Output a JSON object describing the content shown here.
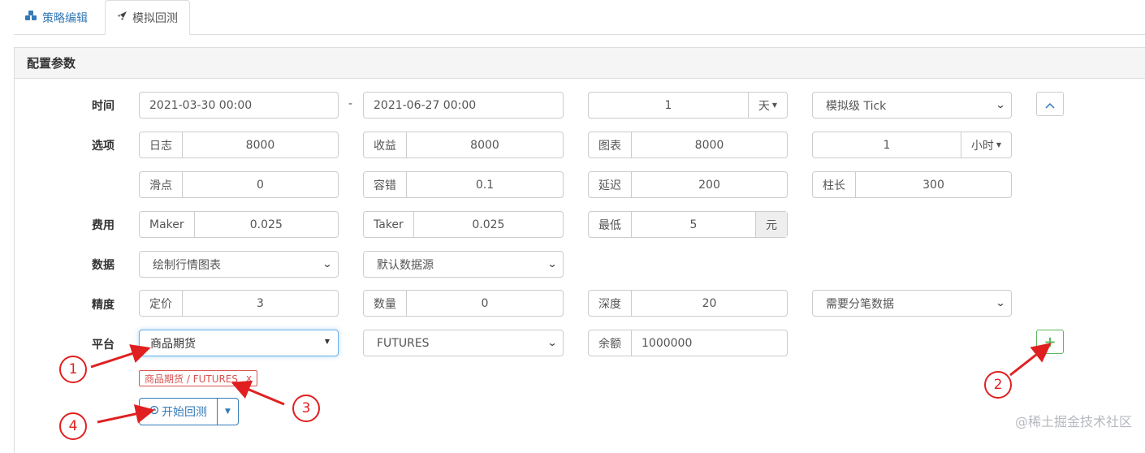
{
  "tabs": {
    "editor": "策略编辑",
    "backtest": "模拟回测"
  },
  "panel": {
    "title": "配置参数"
  },
  "time": {
    "label": "时间",
    "start": "2021-03-30 00:00",
    "separator": "-",
    "end": "2021-06-27 00:00",
    "period_value": "1",
    "period_unit": "天",
    "mode": "模拟级 Tick"
  },
  "options": {
    "label": "选项",
    "log_label": "日志",
    "log_value": "8000",
    "profit_label": "收益",
    "profit_value": "8000",
    "chart_label": "图表",
    "chart_value": "8000",
    "interval_value": "1",
    "interval_unit": "小时",
    "slip_label": "滑点",
    "slip_value": "0",
    "tolerance_label": "容错",
    "tolerance_value": "0.1",
    "delay_label": "延迟",
    "delay_value": "200",
    "bar_label": "柱长",
    "bar_value": "300"
  },
  "fees": {
    "label": "费用",
    "maker_label": "Maker",
    "maker_value": "0.025",
    "taker_label": "Taker",
    "taker_value": "0.025",
    "min_label": "最低",
    "min_value": "5",
    "min_unit": "元"
  },
  "data": {
    "label": "数据",
    "chart_option": "绘制行情图表",
    "source_option": "默认数据源"
  },
  "precision": {
    "label": "精度",
    "price_label": "定价",
    "price_value": "3",
    "qty_label": "数量",
    "qty_value": "0",
    "depth_label": "深度",
    "depth_value": "20",
    "tick_option": "需要分笔数据"
  },
  "platform": {
    "label": "平台",
    "exchange": "商品期货",
    "market": "FUTURES",
    "balance_label": "余额",
    "balance_value": "1000000",
    "tag_text": "商品期货 / FUTURES",
    "tag_close": "x"
  },
  "run": {
    "label": "开始回测"
  },
  "callouts": [
    "1",
    "2",
    "3",
    "4"
  ],
  "watermark": "@稀土掘金技术社区",
  "colors": {
    "primary": "#337ab7",
    "success": "#5cb85c",
    "danger": "#d9534f",
    "callout": "#e02020"
  }
}
